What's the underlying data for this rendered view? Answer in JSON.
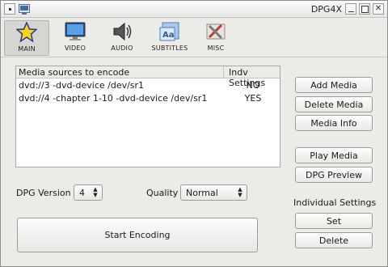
{
  "window": {
    "title": "DPG4X"
  },
  "tabs": [
    {
      "label": "MAIN",
      "icon": "star-icon",
      "active": true
    },
    {
      "label": "VIDEO",
      "icon": "monitor-icon",
      "active": false
    },
    {
      "label": "AUDIO",
      "icon": "speaker-icon",
      "active": false
    },
    {
      "label": "SUBTITLES",
      "icon": "subtitles-icon",
      "active": false
    },
    {
      "label": "MISC",
      "icon": "tools-icon",
      "active": false
    }
  ],
  "media_list": {
    "columns": [
      "Media sources to encode",
      "Indv Settings"
    ],
    "rows": [
      {
        "source": "dvd://3 -dvd-device /dev/sr1",
        "indv": "NO"
      },
      {
        "source": "dvd://4 -chapter 1-10 -dvd-device /dev/sr1",
        "indv": "YES"
      }
    ]
  },
  "side_buttons": {
    "add_media": "Add Media",
    "delete_media": "Delete Media",
    "media_info": "Media Info",
    "play_media": "Play Media",
    "dpg_preview": "DPG Preview"
  },
  "options": {
    "dpg_version_label": "DPG Version",
    "dpg_version_value": "4",
    "quality_label": "Quality",
    "quality_value": "Normal"
  },
  "individual_settings": {
    "heading": "Individual Settings",
    "set": "Set",
    "delete": "Delete"
  },
  "start_button": "Start Encoding"
}
